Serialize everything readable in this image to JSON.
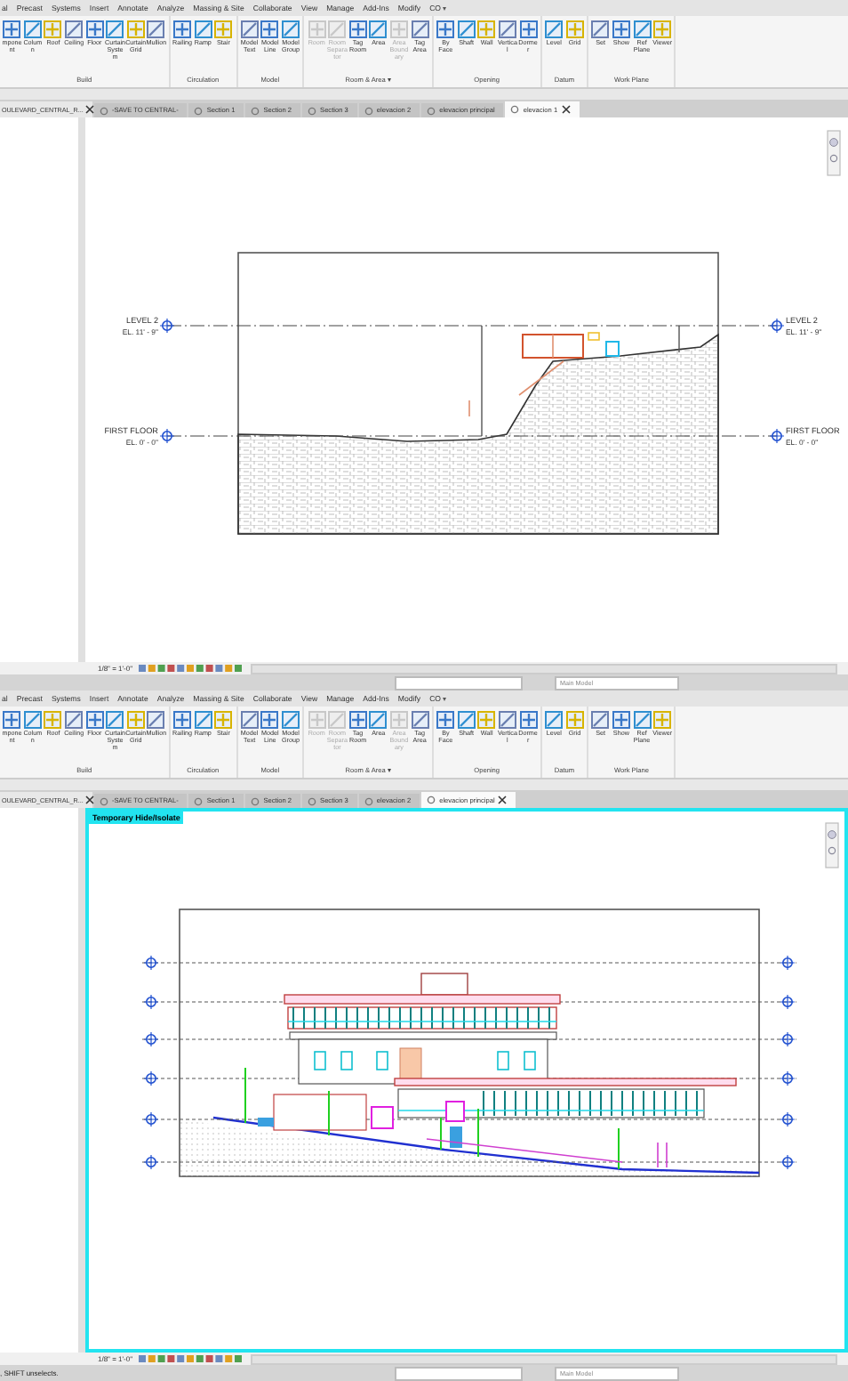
{
  "panes": [
    {
      "menu_tabs": [
        "al",
        "Precast",
        "Systems",
        "Insert",
        "Annotate",
        "Analyze",
        "Massing & Site",
        "Collaborate",
        "View",
        "Manage",
        "Add-Ins",
        "Modify",
        "CO"
      ],
      "ribbon_groups": [
        {
          "label": "Build",
          "buttons": [
            {
              "label": "mponent",
              "disabled": false
            },
            {
              "label": "Column",
              "disabled": false
            },
            {
              "label": "Roof",
              "disabled": false
            },
            {
              "label": "Ceiling",
              "disabled": false
            },
            {
              "label": "Floor",
              "disabled": false
            },
            {
              "label": "Curtain System",
              "disabled": false
            },
            {
              "label": "Curtain Grid",
              "disabled": false
            },
            {
              "label": "Mullion",
              "disabled": false
            }
          ]
        },
        {
          "label": "Circulation",
          "buttons": [
            {
              "label": "Railing",
              "disabled": false
            },
            {
              "label": "Ramp",
              "disabled": false
            },
            {
              "label": "Stair",
              "disabled": false
            }
          ]
        },
        {
          "label": "Model",
          "buttons": [
            {
              "label": "Model Text",
              "disabled": false
            },
            {
              "label": "Model Line",
              "disabled": false
            },
            {
              "label": "Model Group",
              "disabled": false
            }
          ]
        },
        {
          "label": "Room & Area ▾",
          "buttons": [
            {
              "label": "Room",
              "disabled": true
            },
            {
              "label": "Room Separator",
              "disabled": true
            },
            {
              "label": "Tag Room",
              "disabled": false
            },
            {
              "label": "Area",
              "disabled": false
            },
            {
              "label": "Area Boundary",
              "disabled": true
            },
            {
              "label": "Tag Area",
              "disabled": false
            }
          ]
        },
        {
          "label": "Opening",
          "buttons": [
            {
              "label": "By Face",
              "disabled": false
            },
            {
              "label": "Shaft",
              "disabled": false
            },
            {
              "label": "Wall",
              "disabled": false
            },
            {
              "label": "Vertical",
              "disabled": false
            },
            {
              "label": "Dormer",
              "disabled": false
            }
          ]
        },
        {
          "label": "Datum",
          "buttons": [
            {
              "label": "Level",
              "disabled": false
            },
            {
              "label": "Grid",
              "disabled": false
            }
          ]
        },
        {
          "label": "Work Plane",
          "buttons": [
            {
              "label": "Set",
              "disabled": false
            },
            {
              "label": "Show",
              "disabled": false
            },
            {
              "label": "Ref Plane",
              "disabled": false
            },
            {
              "label": "Viewer",
              "disabled": false
            }
          ]
        }
      ],
      "browser_title": "OULEVARD_CENTRAL_R...",
      "view_tabs": [
        {
          "label": "-SAVE TO CENTRAL-",
          "selected": false
        },
        {
          "label": "Section 1",
          "selected": false
        },
        {
          "label": "Section 2",
          "selected": false
        },
        {
          "label": "Section 3",
          "selected": false
        },
        {
          "label": "elevacion 2",
          "selected": false
        },
        {
          "label": "elevacion principal",
          "selected": false
        },
        {
          "label": "elevacion 1",
          "selected": true
        }
      ],
      "isolate_mode": false,
      "drawing": {
        "kind": "terrain",
        "levels": [
          {
            "name_left": "LEVEL 2",
            "elevation_left": "EL. 11' - 9\"",
            "name_right": "LEVEL 2",
            "elevation_right": "EL. 11' - 9\""
          },
          {
            "name_left": "FIRST FLOOR",
            "elevation_left": "EL. 0' - 0\"",
            "name_right": "FIRST FLOOR",
            "elevation_right": "EL. 0' - 0\""
          }
        ]
      },
      "view_scale": "1/8\" = 1'-0\"",
      "status_bar": {
        "workset": "Main Model"
      }
    },
    {
      "menu_tabs": [
        "al",
        "Precast",
        "Systems",
        "Insert",
        "Annotate",
        "Analyze",
        "Massing & Site",
        "Collaborate",
        "View",
        "Manage",
        "Add-Ins",
        "Modify",
        "CO"
      ],
      "ribbon_groups": [
        {
          "label": "Build",
          "buttons": [
            {
              "label": "mponent",
              "disabled": false
            },
            {
              "label": "Column",
              "disabled": false
            },
            {
              "label": "Roof",
              "disabled": false
            },
            {
              "label": "Ceiling",
              "disabled": false
            },
            {
              "label": "Floor",
              "disabled": false
            },
            {
              "label": "Curtain System",
              "disabled": false
            },
            {
              "label": "Curtain Grid",
              "disabled": false
            },
            {
              "label": "Mullion",
              "disabled": false
            }
          ]
        },
        {
          "label": "Circulation",
          "buttons": [
            {
              "label": "Railing",
              "disabled": false
            },
            {
              "label": "Ramp",
              "disabled": false
            },
            {
              "label": "Stair",
              "disabled": false
            }
          ]
        },
        {
          "label": "Model",
          "buttons": [
            {
              "label": "Model Text",
              "disabled": false
            },
            {
              "label": "Model Line",
              "disabled": false
            },
            {
              "label": "Model Group",
              "disabled": false
            }
          ]
        },
        {
          "label": "Room & Area ▾",
          "buttons": [
            {
              "label": "Room",
              "disabled": true
            },
            {
              "label": "Room Separator",
              "disabled": true
            },
            {
              "label": "Tag Room",
              "disabled": false
            },
            {
              "label": "Area",
              "disabled": false
            },
            {
              "label": "Area Boundary",
              "disabled": true
            },
            {
              "label": "Tag Area",
              "disabled": false
            }
          ]
        },
        {
          "label": "Opening",
          "buttons": [
            {
              "label": "By Face",
              "disabled": false
            },
            {
              "label": "Shaft",
              "disabled": false
            },
            {
              "label": "Wall",
              "disabled": false
            },
            {
              "label": "Vertical",
              "disabled": false
            },
            {
              "label": "Dormer",
              "disabled": false
            }
          ]
        },
        {
          "label": "Datum",
          "buttons": [
            {
              "label": "Level",
              "disabled": false
            },
            {
              "label": "Grid",
              "disabled": false
            }
          ]
        },
        {
          "label": "Work Plane",
          "buttons": [
            {
              "label": "Set",
              "disabled": false
            },
            {
              "label": "Show",
              "disabled": false
            },
            {
              "label": "Ref Plane",
              "disabled": false
            },
            {
              "label": "Viewer",
              "disabled": false
            }
          ]
        }
      ],
      "browser_title": "OULEVARD_CENTRAL_R...",
      "view_tabs": [
        {
          "label": "-SAVE TO CENTRAL-",
          "selected": false
        },
        {
          "label": "Section 1",
          "selected": false
        },
        {
          "label": "Section 2",
          "selected": false
        },
        {
          "label": "Section 3",
          "selected": false
        },
        {
          "label": "elevacion 2",
          "selected": false
        },
        {
          "label": "elevacion principal",
          "selected": true
        }
      ],
      "isolate_mode": true,
      "isolate_banner": "Temporary Hide/Isolate",
      "drawing": {
        "kind": "building"
      },
      "view_scale": "1/8\" = 1'-0\"",
      "status_bar": {
        "message": ", SHIFT unselects.",
        "workset": "Main Model"
      }
    }
  ]
}
